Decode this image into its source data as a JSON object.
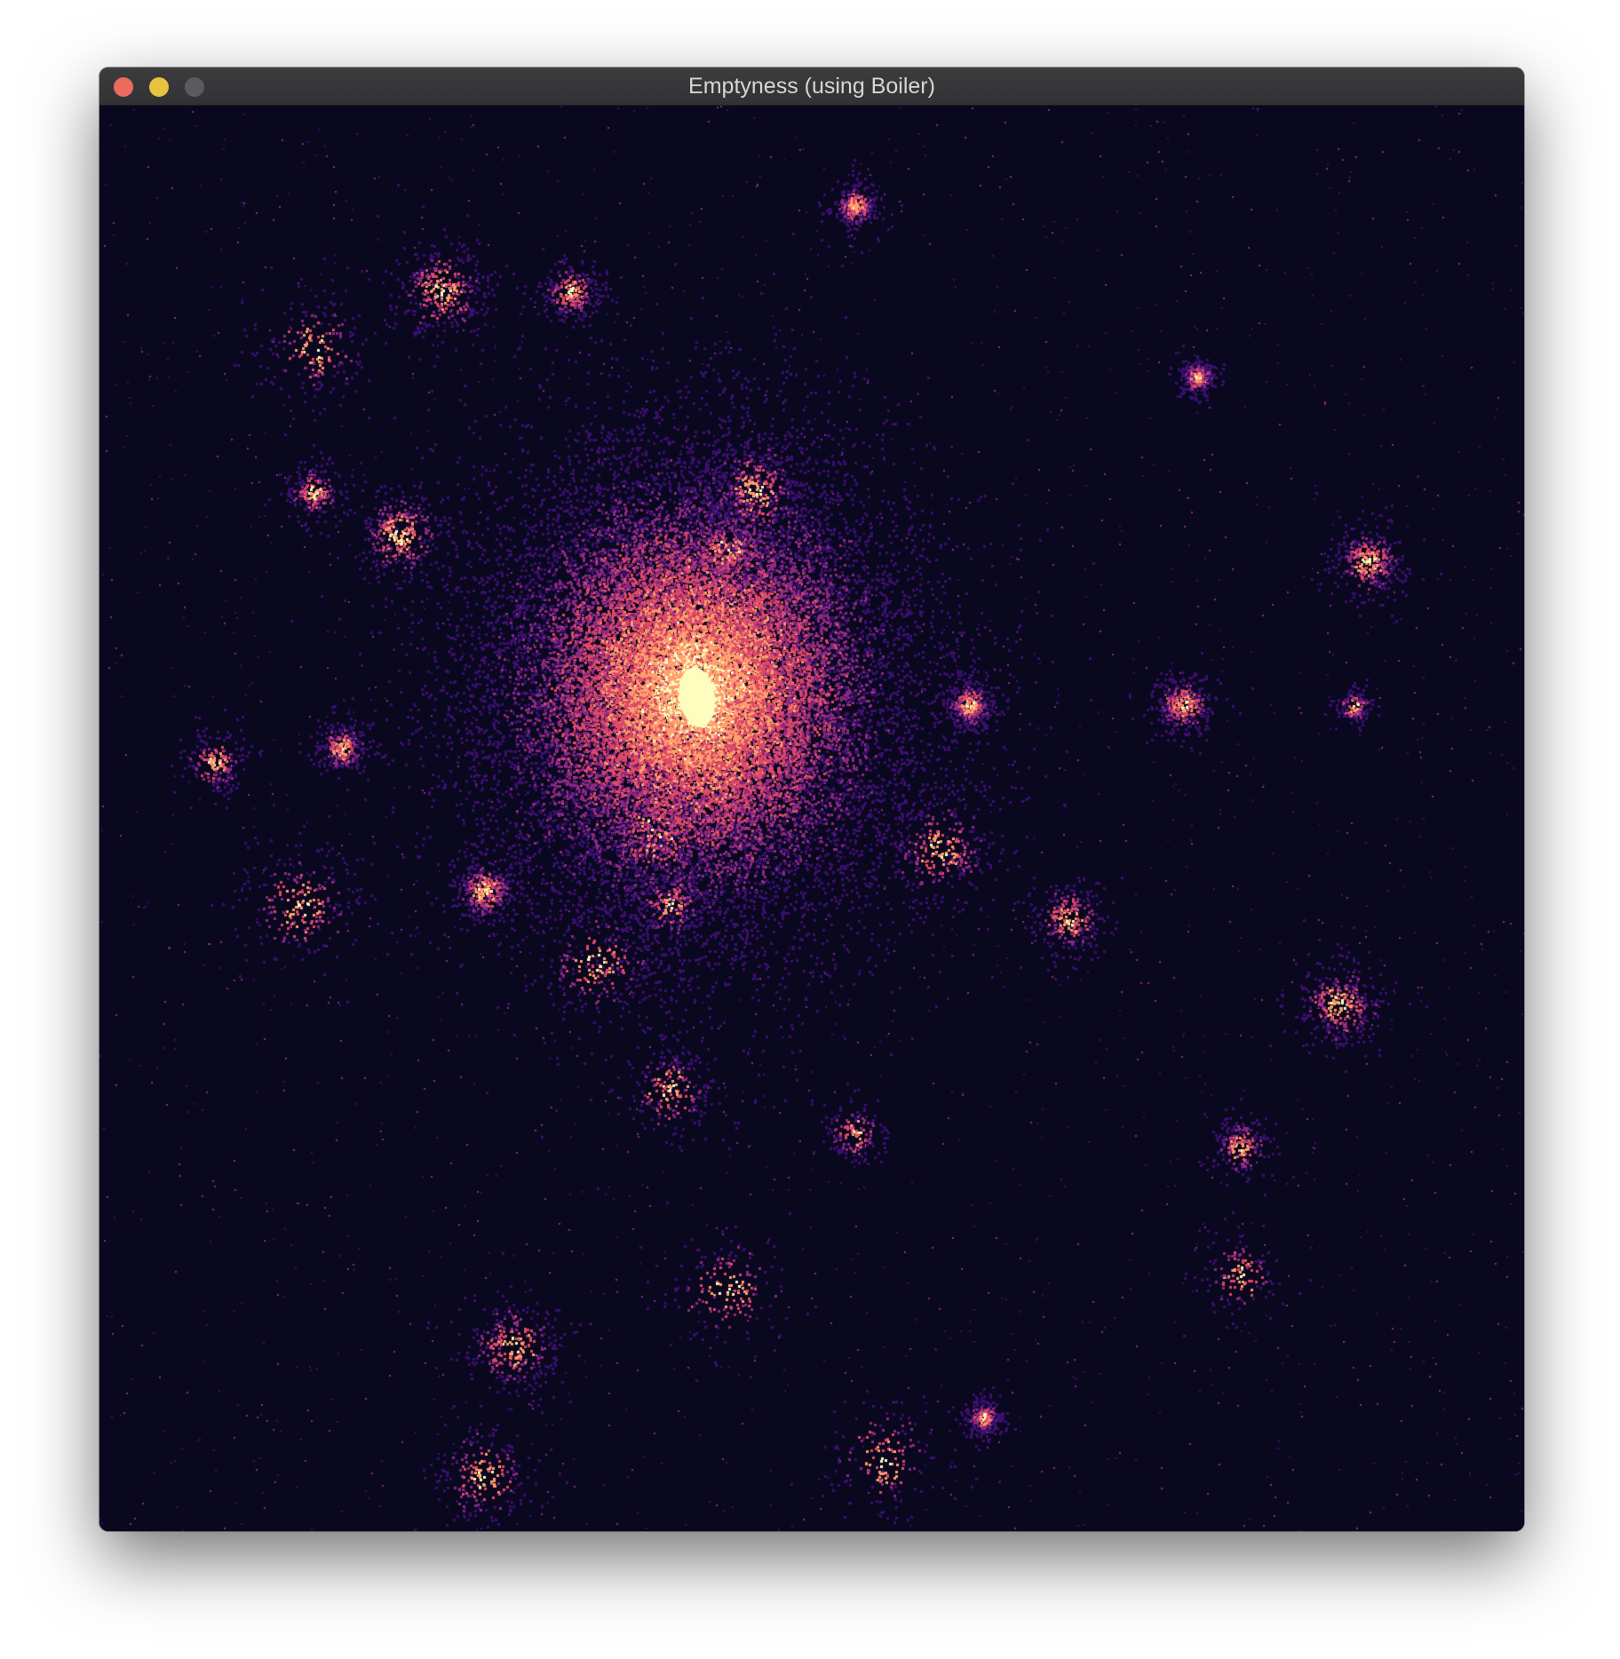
{
  "window": {
    "title": "Emptyness (using Boiler)",
    "controls": {
      "close_color": "#ec6a5e",
      "minimize_color": "#e5c33f",
      "zoom_color": "#5b5b5d"
    }
  },
  "visualization": {
    "background_color": "#0a081f",
    "colormap": [
      "#0a081f",
      "#3b0f6f",
      "#8c2981",
      "#de4968",
      "#fe9f6d",
      "#fcfdbf"
    ],
    "description_of_content": "density scatter of particles with a bright central cluster and many small satellite clusters"
  }
}
